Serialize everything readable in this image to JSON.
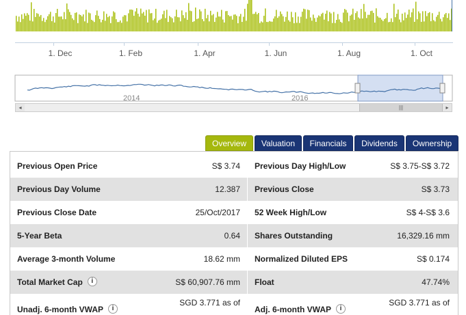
{
  "chart": {
    "volume_color": "#a9bf10",
    "x_axis_labels": [
      "1. Dec",
      "1. Feb",
      "1. Apr",
      "1. Jun",
      "1. Aug",
      "1. Oct"
    ],
    "navigator_labels": [
      "2014",
      "2016"
    ],
    "navigator_line_color": "#4572a7",
    "scroll_left_arrow": "◂",
    "scroll_right_arrow": "▸",
    "scroll_grip": "|||"
  },
  "tabs": [
    {
      "label": "Overview",
      "active": true
    },
    {
      "label": "Valuation",
      "active": false
    },
    {
      "label": "Financials",
      "active": false
    },
    {
      "label": "Dividends",
      "active": false
    },
    {
      "label": "Ownership",
      "active": false
    }
  ],
  "table": {
    "rows": [
      {
        "left_label": "Previous Open Price",
        "left_value": "S$ 3.74",
        "right_label": "Previous Day High/Low",
        "right_value": "S$ 3.75-S$ 3.72"
      },
      {
        "left_label": "Previous Day Volume",
        "left_value": "12.387",
        "right_label": "Previous Close",
        "right_value": "S$ 3.73"
      },
      {
        "left_label": "Previous Close Date",
        "left_value": "25/Oct/2017",
        "right_label": "52 Week High/Low",
        "right_value": "S$ 4-S$ 3.6"
      },
      {
        "left_label": "5-Year Beta",
        "left_value": "0.64",
        "right_label": "Shares Outstanding",
        "right_value": "16,329.16 mm"
      },
      {
        "left_label": "Average 3-month Volume",
        "left_value": "18.62 mm",
        "right_label": "Normalized Diluted EPS",
        "right_value": "S$ 0.174"
      },
      {
        "left_label": "Total Market Cap",
        "left_value": "S$ 60,907.76 mm",
        "right_label": "Float",
        "right_value": "47.74%"
      },
      {
        "left_label": "Unadj. 6-month VWAP",
        "left_value": "SGD 3.771 as of",
        "right_label": "Adj. 6-month VWAP",
        "right_value": "SGD 3.771 as of"
      }
    ],
    "info_icon": "i"
  }
}
